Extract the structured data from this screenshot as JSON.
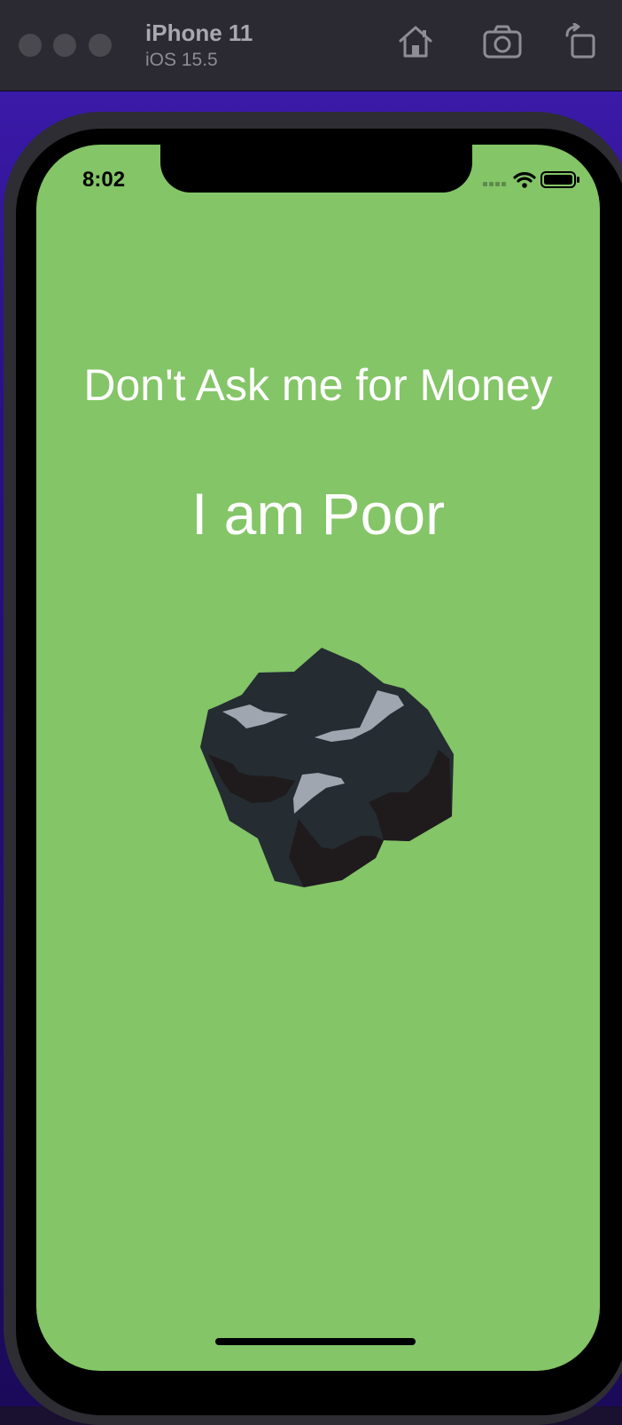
{
  "simulator": {
    "device_name": "iPhone 11",
    "os_version": "iOS 15.5",
    "toolbar_icons": [
      "home-icon",
      "screenshot-camera-icon",
      "rotate-icon"
    ]
  },
  "status_bar": {
    "time": "8:02",
    "icons": [
      "cellular-signal-icon",
      "wifi-icon",
      "battery-icon"
    ]
  },
  "app": {
    "background_color": "#84c567",
    "headline": "Don't Ask me for Money",
    "subhead": "I am Poor",
    "image": "coal-image"
  }
}
